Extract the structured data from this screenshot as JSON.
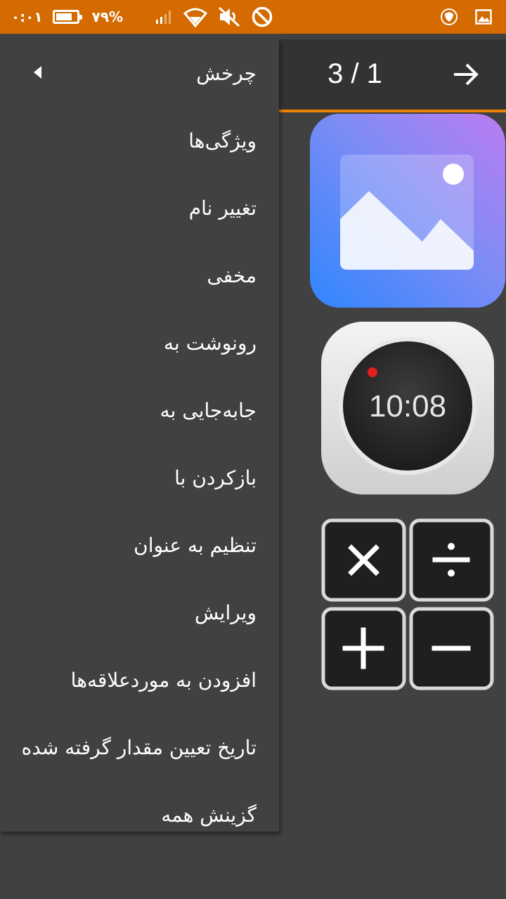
{
  "status_bar": {
    "time": "۰:۰۱",
    "battery_percent_label": "۷۹%",
    "battery_level": 0.79,
    "icons": [
      "signal-icon",
      "wifi-icon",
      "mute-icon",
      "do-not-disturb-icon",
      "shield-icon",
      "image-icon"
    ]
  },
  "toolbar": {
    "page_counter": "3 / 1",
    "arrow_icon": "arrow-right-icon"
  },
  "colors": {
    "status_bar": "#d46a00",
    "accent_line": "#e98300",
    "background": "#414141",
    "toolbar": "#333333"
  },
  "tiles": {
    "clock_time": "10:08"
  },
  "menu": {
    "items": [
      {
        "label": "چرخش",
        "has_submenu": true
      },
      {
        "label": "ویژگی‌ها"
      },
      {
        "label": "تغییر نام"
      },
      {
        "label": "مخفی"
      },
      {
        "label": "رونوشت به"
      },
      {
        "label": "جابه‌جایی به"
      },
      {
        "label": "بازکردن با"
      },
      {
        "label": "تنظیم به عنوان"
      },
      {
        "label": "ویرایش"
      },
      {
        "label": "افزودن به موردعلاقه‌ها"
      },
      {
        "label": "تاریخ تعیین مقدار گرفته شده"
      },
      {
        "label": "گزینش همه"
      }
    ]
  }
}
